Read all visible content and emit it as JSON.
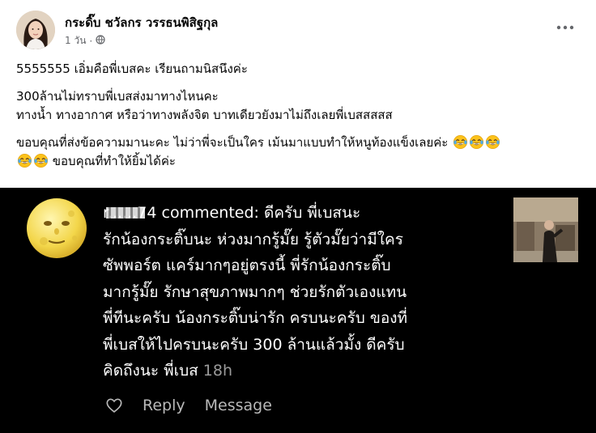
{
  "post": {
    "author": "กระดิ๊บ ชวัลกร วรรธนพิสิฐกุล",
    "time": "1 วัน",
    "privacy_icon": "public-globe-icon",
    "more_icon": "more-horizontal-icon",
    "paragraphs": {
      "p1": "5555555 เอิ่มคือพี่เบสคะ เรียนถามนิสนึงค่ะ",
      "p2_line1": "300ล้านไม่ทราบพี่เบสส่งมาทางไหนคะ",
      "p2_line2": "ทางน้ำ ทางอากาศ หรือว่าทางพลังจิต บาทเดียวยังมาไม่ถึงเลยพี่เบสสสสส",
      "p3_line1": "ขอบคุณที่ส่งข้อความมานะคะ ไม่ว่าพี่จะเป็นใคร เม้นมาแบบทำให้หนูท้องแข็งเลยค่ะ",
      "p3_line2": "ขอบคุณที่ทำให้ยิ้มได้ค่ะ"
    },
    "emoji": "face-with-tears-of-joy"
  },
  "comment": {
    "avatar_icon": "full-moon-face-icon",
    "username": "r......74",
    "verb": "commented:",
    "lines": [
      "ดีครับ พี่เบสนะ",
      "รักน้องกระติ๊บนะ ห่วงมากรู้มั๊ย รู้ตัวมั๊ยว่ามีใคร",
      "ซัพพอร์ต แคร์มากๆอยู่ตรงนี้ พี่รักน้องกระติ๊บ",
      "มากรู้มั๊ย  รักษาสุขภาพมากๆ ช่วยรักตัวเองแทน",
      "พี่ทีนะครับ น้องกระติ๊บน่ารัก  ครบนะครับ ของที่",
      "พี่เบสให้ไปครบนะครับ 300 ล้านแล้วมั้ง ดีครับ",
      "คิดถึงนะ  พี่เบส"
    ],
    "time": "18h",
    "like_icon": "heart-outline-icon",
    "reply_label": "Reply",
    "message_label": "Message"
  },
  "colors": {
    "post_bg": "#ffffff",
    "text_primary": "#050505",
    "text_secondary": "#65676b",
    "comment_bg": "#000000",
    "comment_text": "#ffffff",
    "comment_muted": "#b9b9b9"
  }
}
